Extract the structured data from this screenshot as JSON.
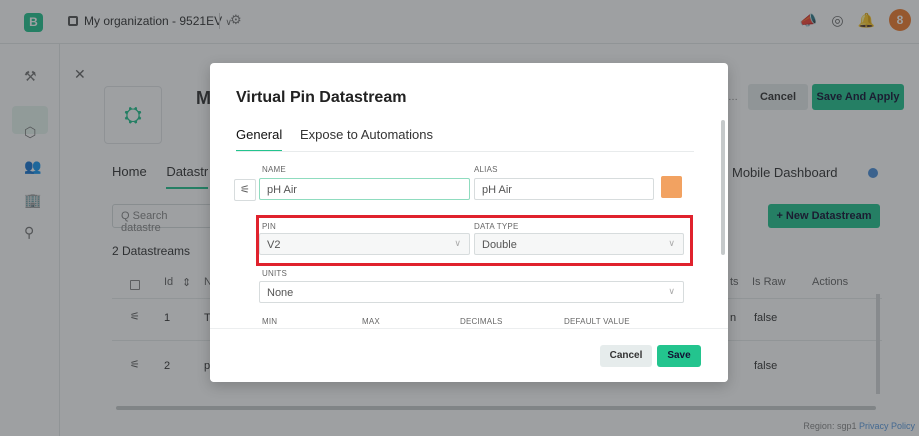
{
  "topbar": {
    "logo": "B",
    "org_name": "My organization - 9521EV",
    "org_chevron": "∨",
    "avatar": "8"
  },
  "page": {
    "device_title": "M",
    "cancel_label": "Cancel",
    "save_apply_label": "Save And Apply",
    "tabs": [
      "Home",
      "Datastr"
    ],
    "mobile_tab": "Mobile Dashboard",
    "search_placeholder": "Q  Search datastre",
    "new_datastream_label": "+  New Datastream",
    "count_label": "2 Datastreams",
    "columns": {
      "id": "Id",
      "name": "N",
      "is_raw": "Is Raw",
      "actions": "Actions",
      "units_col": "ts"
    },
    "rows": [
      {
        "id": "1",
        "name": "T",
        "extra": "n",
        "is_raw": "false"
      },
      {
        "id": "2",
        "name": "p",
        "extra": "",
        "is_raw": "false"
      }
    ],
    "footer_region": "Region: sgp1",
    "footer_privacy": "Privacy Policy"
  },
  "modal": {
    "title": "Virtual Pin Datastream",
    "tabs": [
      "General",
      "Expose to Automations"
    ],
    "name_label": "NAME",
    "name_value": "pH Air",
    "alias_label": "ALIAS",
    "alias_value": "pH Air",
    "pin_label": "PIN",
    "pin_value": "V2",
    "data_type_label": "DATA TYPE",
    "data_type_value": "Double",
    "units_label": "UNITS",
    "units_value": "None",
    "min_label": "MIN",
    "max_label": "MAX",
    "decimals_label": "DECIMALS",
    "default_value_label": "DEFAULT VALUE",
    "cancel_label": "Cancel",
    "save_label": "Save",
    "color": "#f2a261"
  },
  "colors": {
    "brand_green": "#23c48e",
    "highlight_red": "#e0222d",
    "avatar_orange": "#f07c2f"
  }
}
